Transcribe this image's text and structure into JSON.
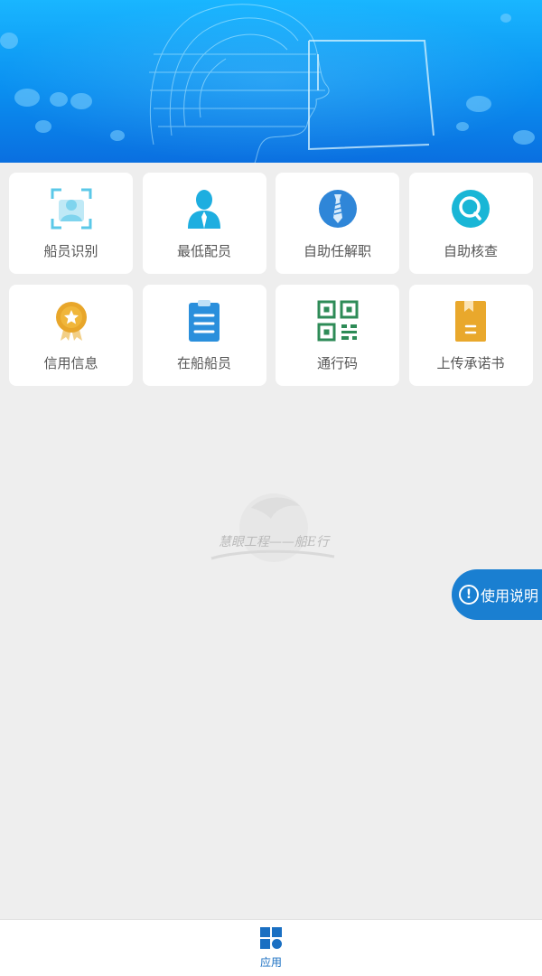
{
  "banner": {
    "icon": "face-scan-illustration"
  },
  "menu": {
    "items": [
      {
        "label": "船员识别",
        "icon": "face-scan-icon",
        "color": "#5bc8e8"
      },
      {
        "label": "最低配员",
        "icon": "person-icon",
        "color": "#1eaee0"
      },
      {
        "label": "自助任解职",
        "icon": "tie-icon",
        "color": "#2f86d8"
      },
      {
        "label": "自助核查",
        "icon": "search-circle-icon",
        "color": "#19b6d6"
      },
      {
        "label": "信用信息",
        "icon": "medal-icon",
        "color": "#e8a62a"
      },
      {
        "label": "在船船员",
        "icon": "clipboard-icon",
        "color": "#2a8fdc"
      },
      {
        "label": "通行码",
        "icon": "qr-code-icon",
        "color": "#2e8b57"
      },
      {
        "label": "上传承诺书",
        "icon": "book-icon",
        "color": "#e9a82c"
      }
    ]
  },
  "watermark": {
    "text": "慧眼工程——船E行"
  },
  "help_button": {
    "label": "使用说明",
    "icon": "info-icon"
  },
  "tabbar": {
    "items": [
      {
        "label": "应用",
        "icon": "apps-icon",
        "color": "#1a6fc2"
      }
    ]
  }
}
